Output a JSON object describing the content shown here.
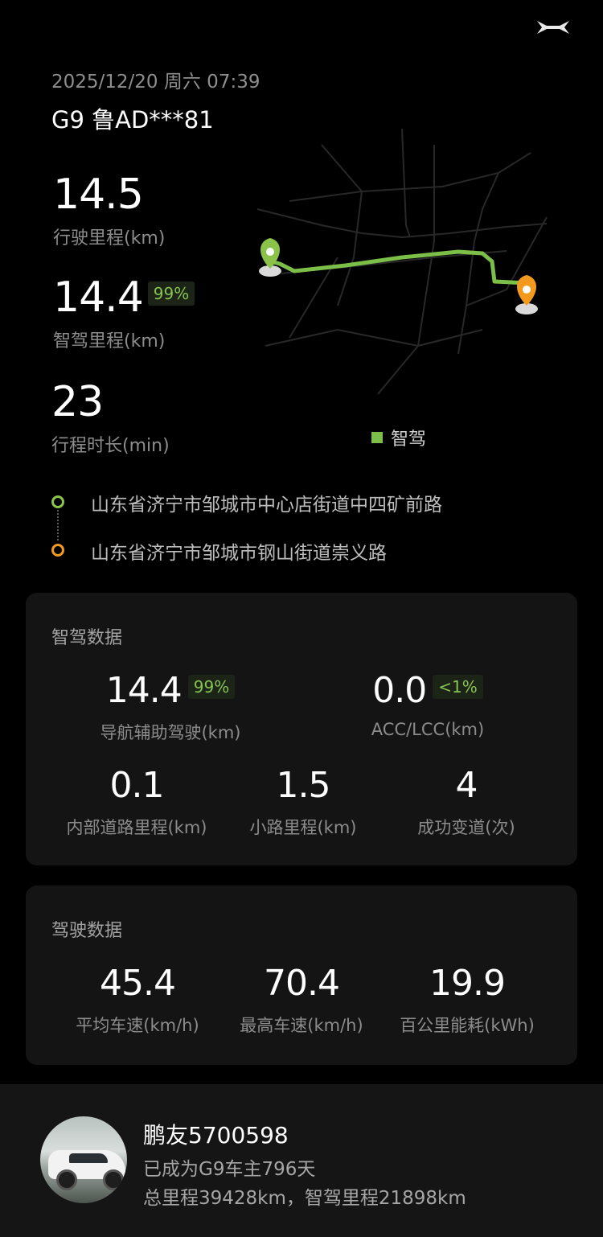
{
  "header": {
    "datetime": "2025/12/20 周六 07:39",
    "vehicle": "G9 鲁AD***81"
  },
  "stats": {
    "distance_value": "14.5",
    "distance_label": "行驶里程(km)",
    "smart_distance_value": "14.4",
    "smart_distance_pct": "99%",
    "smart_distance_label": "智驾里程(km)",
    "duration_value": "23",
    "duration_label": "行程时长(min)"
  },
  "map": {
    "legend_label": "智驾",
    "route_color": "#7cbf48",
    "start_color": "#8bc34a",
    "end_color": "#f39a1e"
  },
  "route": {
    "start": "山东省济宁市邹城市中心店街道中四矿前路",
    "end": "山东省济宁市邹城市钢山街道崇义路"
  },
  "smart_data": {
    "title": "智驾数据",
    "nav_value": "14.4",
    "nav_pct": "99%",
    "nav_label": "导航辅助驾驶(km)",
    "acc_value": "0.0",
    "acc_pct": "<1%",
    "acc_label": "ACC/LCC(km)",
    "internal_value": "0.1",
    "internal_label": "内部道路里程(km)",
    "small_value": "1.5",
    "small_label": "小路里程(km)",
    "lane_value": "4",
    "lane_label": "成功变道(次)"
  },
  "driving_data": {
    "title": "驾驶数据",
    "avg_value": "45.4",
    "avg_label": "平均车速(km/h)",
    "max_value": "70.4",
    "max_label": "最高车速(km/h)",
    "energy_value": "19.9",
    "energy_label": "百公里能耗(kWh)"
  },
  "user": {
    "name": "鹏友5700598",
    "owner_line": "已成为G9车主796天",
    "mileage_line": "总里程39428km，智驾里程21898km"
  }
}
